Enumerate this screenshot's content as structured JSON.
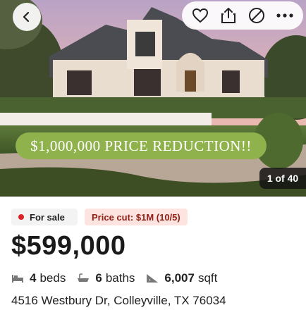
{
  "hero": {
    "banner_text": "$1,000,000 PRICE REDUCTION!!",
    "photo_counter": "1 of 40",
    "actions": [
      "back-icon",
      "heart-icon",
      "share-icon",
      "hide-icon",
      "more-icon"
    ]
  },
  "status": {
    "for_sale_label": "For sale",
    "price_cut_label": "Price cut: $1M (10/5)"
  },
  "listing": {
    "price": "$599,000",
    "beds_value": "4",
    "beds_unit": "beds",
    "baths_value": "6",
    "baths_unit": "baths",
    "sqft_value": "6,007",
    "sqft_unit": "sqft",
    "address": "4516 Westbury Dr, Colleyville, TX 76034"
  },
  "colors": {
    "accent_red": "#d92228",
    "price_cut_bg": "#fde4e1",
    "banner_green": "#8fb24d"
  }
}
